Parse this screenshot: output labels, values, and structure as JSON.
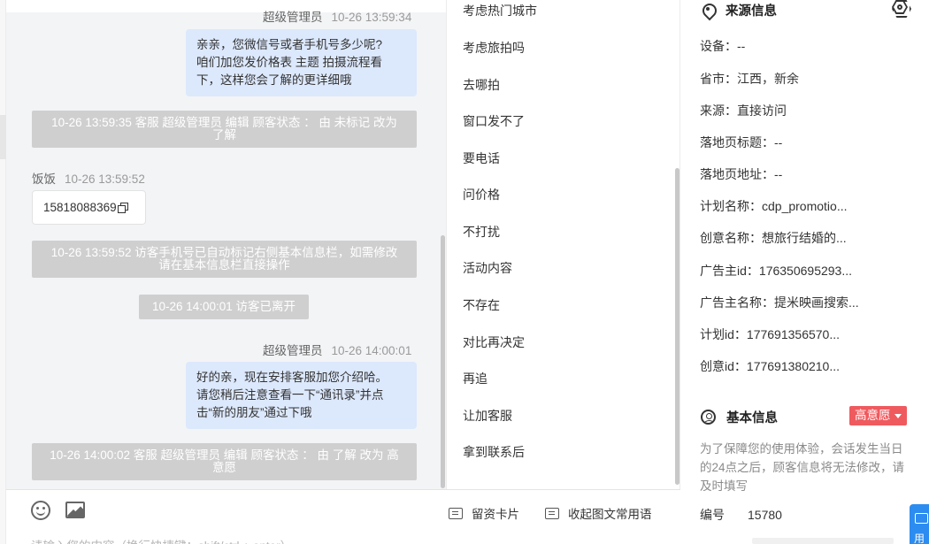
{
  "chat": {
    "messages": [
      {
        "type": "out_meta",
        "sender": "超级管理员",
        "time": "10-26 13:59:34"
      },
      {
        "type": "out",
        "lines": [
          "亲亲，您微信号或者手机号多少呢?",
          "咱们加您发价格表 主题 拍摄流程看",
          "下，这样您会了解的更详细哦"
        ]
      },
      {
        "type": "system",
        "lines": [
          "10-26 13:59:35 客服 超级管理员 编辑 顾客状态 ： 由 未标记 改为",
          "了解"
        ]
      },
      {
        "type": "in_meta",
        "sender": "饭饭",
        "time": "10-26 13:59:52"
      },
      {
        "type": "in",
        "text": "15818088369"
      },
      {
        "type": "system",
        "lines": [
          "10-26 13:59:52 访客手机号已自动标记右侧基本信息栏，如需修改",
          "请在基本信息栏直接操作"
        ]
      },
      {
        "type": "system",
        "lines": [
          "10-26 14:00:01 访客已离开"
        ]
      },
      {
        "type": "out_meta",
        "sender": "超级管理员",
        "time": "10-26 14:00:01"
      },
      {
        "type": "out",
        "lines": [
          "好的亲，现在安排客服加您介绍哈。",
          "请您稍后注意查看一下“通讯录”并点",
          "击“新的朋友”通过下哦"
        ]
      },
      {
        "type": "system",
        "lines": [
          "10-26 14:00:02 客服 超级管理员 编辑 顾客状态 ： 由 了解 改为 高",
          "意愿"
        ]
      }
    ]
  },
  "composer": {
    "emoji_icon": "emoji-icon",
    "image_icon": "image-icon",
    "card_button": "留资卡片",
    "phrases_button": "收起图文常用语",
    "placeholder": "请输入您的内容（换行快捷键：shift/ctrl + enter）"
  },
  "phrases": [
    "考虑热门城市",
    "考虑旅拍吗",
    "去哪拍",
    "窗口发不了",
    "要电话",
    "问价格",
    "不打扰",
    "活动内容",
    "不存在",
    "对比再决定",
    "再追",
    "让加客服",
    "拿到联系后"
  ],
  "source_info": {
    "title": "来源信息",
    "rows": [
      {
        "label": "设备：",
        "value": "--"
      },
      {
        "label": "省市：",
        "value": "江西，新余"
      },
      {
        "label": "来源：",
        "value": "直接访问"
      },
      {
        "label": "落地页标题：",
        "value": "--"
      },
      {
        "label": "落地页地址：",
        "value": "--"
      },
      {
        "label": "计划名称：",
        "value": "cdp_promotio..."
      },
      {
        "label": "创意名称：",
        "value": "想旅行结婚的..."
      },
      {
        "label": "广告主id：",
        "value": "176350695293..."
      },
      {
        "label": "广告主名称：",
        "value": "提米映画搜索..."
      },
      {
        "label": "计划id：",
        "value": "177691356570..."
      },
      {
        "label": "创意id：",
        "value": "177691380210..."
      }
    ]
  },
  "basic_info": {
    "title": "基本信息",
    "intent_badge": "高意愿",
    "badge_color": "#ef5a5e",
    "notice": "为了保障您的使用体验，会话发生当日的24点之后，顾客信息将无法修改，请及时填写",
    "id_label": "编号",
    "id_value": "15780",
    "float_button_text": "用"
  }
}
